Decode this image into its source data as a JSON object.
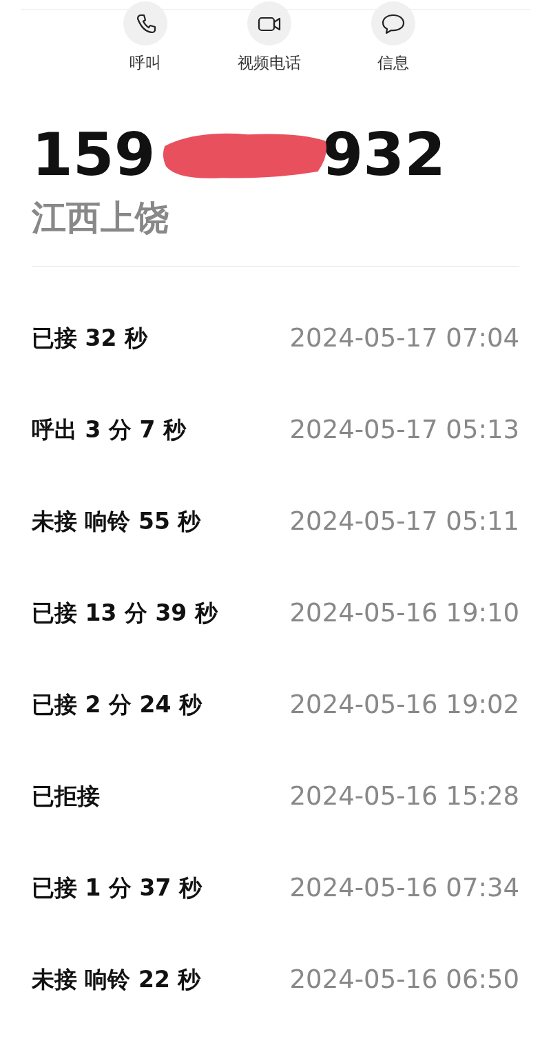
{
  "actions": [
    {
      "kind": "call",
      "label": "呼叫"
    },
    {
      "kind": "video",
      "label": "视频电话"
    },
    {
      "kind": "message",
      "label": "信息"
    }
  ],
  "contact": {
    "number_start": "159",
    "number_end": "932",
    "location": "江西上饶"
  },
  "call_log": [
    {
      "summary": "已接 32 秒",
      "time": "2024-05-17 07:04"
    },
    {
      "summary": "呼出 3 分 7 秒",
      "time": "2024-05-17 05:13"
    },
    {
      "summary": "未接 响铃 55 秒",
      "time": "2024-05-17 05:11"
    },
    {
      "summary": "已接 13 分 39 秒",
      "time": "2024-05-16 19:10"
    },
    {
      "summary": "已接 2 分 24 秒",
      "time": "2024-05-16 19:02"
    },
    {
      "summary": "已拒接",
      "time": "2024-05-16 15:28"
    },
    {
      "summary": "已接 1 分 37 秒",
      "time": "2024-05-16 07:34"
    },
    {
      "summary": "未接 响铃 22 秒",
      "time": "2024-05-16 06:50"
    }
  ]
}
